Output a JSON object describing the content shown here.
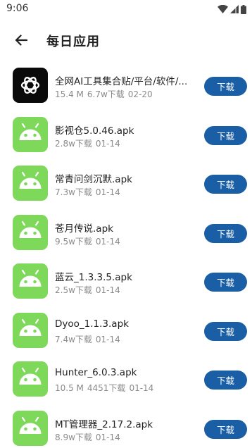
{
  "status_bar": {
    "time": "9:06"
  },
  "header": {
    "title": "每日应用"
  },
  "colors": {
    "download_button": "#1a5ea6",
    "android_icon": "#7ed85a",
    "meta_text": "#8a8a8a"
  },
  "apps": [
    {
      "name": "全网AI工具集合贴/平台/软件/...",
      "size": "15.4 M",
      "downloads": "6.7w下载",
      "date": "02-20",
      "icon": "openai-icon",
      "button": "下载"
    },
    {
      "name": "影视仓5.0.46.apk",
      "size": "",
      "downloads": "2.8w下载",
      "date": "01-14",
      "icon": "android-icon",
      "button": "下载"
    },
    {
      "name": "常青问剑沉默.apk",
      "size": "",
      "downloads": "7.3w下载",
      "date": "01-14",
      "icon": "android-icon",
      "button": "下载"
    },
    {
      "name": "苍月传说.apk",
      "size": "",
      "downloads": "9.5w下载",
      "date": "01-14",
      "icon": "android-icon",
      "button": "下载"
    },
    {
      "name": "蓝云_1.3.3.5.apk",
      "size": "",
      "downloads": "2.5w下载",
      "date": "01-14",
      "icon": "android-icon",
      "button": "下载"
    },
    {
      "name": "Dyoo_1.1.3.apk",
      "size": "",
      "downloads": "7.4w下载",
      "date": "01-14",
      "icon": "android-icon",
      "button": "下载"
    },
    {
      "name": "Hunter_6.0.3.apk",
      "size": "10.5 M",
      "downloads": "4451下载",
      "date": "01-14",
      "icon": "android-icon",
      "button": "下载"
    },
    {
      "name": "MT管理器_2.17.2.apk",
      "size": "",
      "downloads": "8.9w下载",
      "date": "01-14",
      "icon": "android-icon",
      "button": "下载"
    }
  ]
}
